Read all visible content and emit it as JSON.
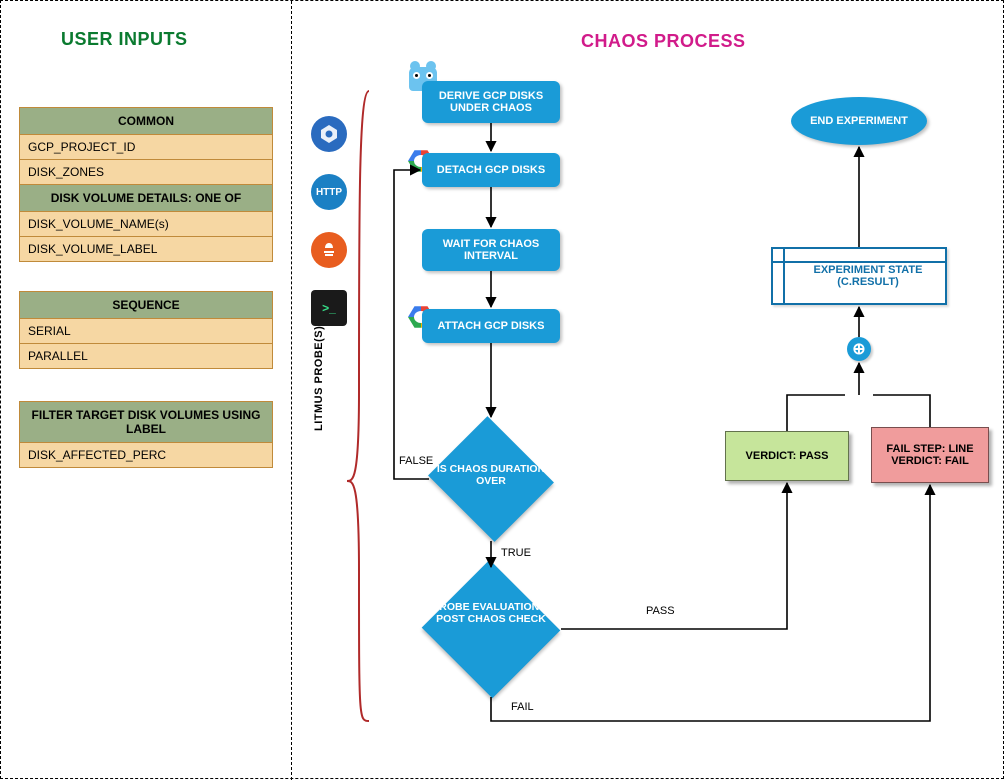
{
  "titles": {
    "left": "USER INPUTS",
    "right": "CHAOS PROCESS"
  },
  "tables": {
    "common": {
      "header": "COMMON",
      "rows": [
        "GCP_PROJECT_ID",
        "DISK_ZONES"
      ]
    },
    "volume": {
      "header": "DISK VOLUME DETAILS: ONE OF",
      "rows": [
        "DISK_VOLUME_NAME(s)",
        "DISK_VOLUME_LABEL"
      ]
    },
    "sequence": {
      "header": "SEQUENCE",
      "rows": [
        "SERIAL",
        "PARALLEL"
      ]
    },
    "filter": {
      "header": "FILTER TARGET DISK VOLUMES USING LABEL",
      "rows": [
        "DISK_AFFECTED_PERC"
      ]
    }
  },
  "probes": {
    "label": "LITMUS PROBE(S)",
    "icons": [
      "k8s-icon",
      "http-icon",
      "prometheus-icon",
      "terminal-icon"
    ],
    "http_text": "HTTP"
  },
  "process": {
    "derive": "DERIVE GCP DISKS UNDER CHAOS",
    "detach": "DETACH GCP DISKS",
    "wait": "WAIT FOR CHAOS INTERVAL",
    "attach": "ATTACH GCP DISKS",
    "decision_duration": "IS CHAOS DURATION OVER",
    "decision_probe": "PROBE EVALUATION & POST CHAOS CHECK",
    "end": "END EXPERIMENT",
    "state": "EXPERIMENT STATE (C.RESULT)",
    "verdict_pass": "VERDICT: PASS",
    "verdict_fail": "FAIL STEP: LINE VERDICT: FAIL",
    "plus": "⊕"
  },
  "edges": {
    "false": "FALSE",
    "true": "TRUE",
    "pass": "PASS",
    "fail": "FAIL"
  },
  "chart_data": {
    "type": "flowchart",
    "nodes": [
      {
        "id": "derive",
        "label": "DERIVE GCP DISKS UNDER CHAOS",
        "shape": "process"
      },
      {
        "id": "detach",
        "label": "DETACH GCP DISKS",
        "shape": "process"
      },
      {
        "id": "wait",
        "label": "WAIT FOR CHAOS INTERVAL",
        "shape": "process"
      },
      {
        "id": "attach",
        "label": "ATTACH GCP DISKS",
        "shape": "process"
      },
      {
        "id": "dur",
        "label": "IS CHAOS DURATION OVER",
        "shape": "decision"
      },
      {
        "id": "probe",
        "label": "PROBE EVALUATION & POST CHAOS CHECK",
        "shape": "decision"
      },
      {
        "id": "pass",
        "label": "VERDICT: PASS",
        "shape": "result"
      },
      {
        "id": "fail",
        "label": "FAIL STEP: LINE VERDICT: FAIL",
        "shape": "result"
      },
      {
        "id": "merge",
        "label": "+",
        "shape": "merge"
      },
      {
        "id": "state",
        "label": "EXPERIMENT STATE (C.RESULT)",
        "shape": "process"
      },
      {
        "id": "end",
        "label": "END EXPERIMENT",
        "shape": "terminator"
      }
    ],
    "edges": [
      {
        "from": "derive",
        "to": "detach"
      },
      {
        "from": "detach",
        "to": "wait"
      },
      {
        "from": "wait",
        "to": "attach"
      },
      {
        "from": "attach",
        "to": "dur"
      },
      {
        "from": "dur",
        "to": "detach",
        "label": "FALSE"
      },
      {
        "from": "dur",
        "to": "probe",
        "label": "TRUE"
      },
      {
        "from": "probe",
        "to": "pass",
        "label": "PASS"
      },
      {
        "from": "probe",
        "to": "fail",
        "label": "FAIL"
      },
      {
        "from": "pass",
        "to": "merge"
      },
      {
        "from": "fail",
        "to": "merge"
      },
      {
        "from": "merge",
        "to": "state"
      },
      {
        "from": "state",
        "to": "end"
      }
    ],
    "inputs": {
      "COMMON": [
        "GCP_PROJECT_ID",
        "DISK_ZONES"
      ],
      "DISK VOLUME DETAILS: ONE OF": [
        "DISK_VOLUME_NAME(s)",
        "DISK_VOLUME_LABEL"
      ],
      "SEQUENCE": [
        "SERIAL",
        "PARALLEL"
      ],
      "FILTER TARGET DISK VOLUMES USING LABEL": [
        "DISK_AFFECTED_PERC"
      ]
    },
    "probes": [
      "k8s",
      "http",
      "prometheus",
      "cmd"
    ]
  }
}
